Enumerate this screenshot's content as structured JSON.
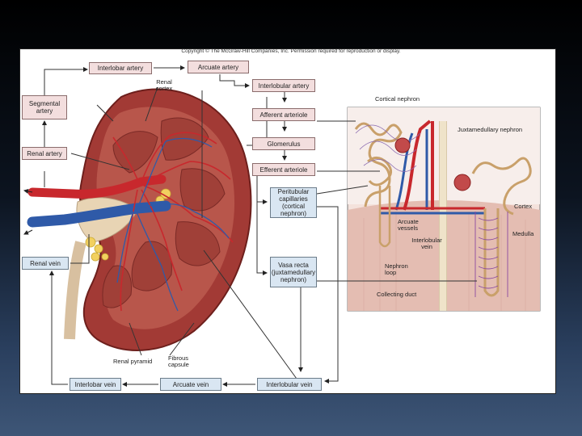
{
  "copyright": "Copyright © The McGraw-Hill Companies, Inc. Permission required for reproduction or display.",
  "flow_boxes": {
    "interlobar_artery": "Interlobar artery",
    "arcuate_artery": "Arcuate artery",
    "interlobular_artery": "Interlobular artery",
    "afferent_arteriole": "Afferent arteriole",
    "glomerulus": "Glomerulus",
    "efferent_arteriole": "Efferent arteriole",
    "peritubular_capillaries": "Peritubular capillaries (cortical nephron)",
    "vasa_recta": "Vasa recta (juxtamedullary nephron)",
    "segmental_artery": "Segmental artery",
    "renal_artery": "Renal artery",
    "renal_vein": "Renal vein",
    "interlobar_vein": "Interlobar vein",
    "arcuate_vein": "Arcuate vein",
    "interlobular_vein": "Interlobular vein"
  },
  "kidney_labels": {
    "renal_cortex": "Renal cortex",
    "renal_pyramid": "Renal pyramid",
    "fibrous_capsule": "Fibrous capsule"
  },
  "nephron_labels": {
    "cortical_nephron": "Cortical nephron",
    "juxtamedullary_nephron": "Juxtamedullary nephron",
    "cortex": "Cortex",
    "medulla": "Medulla",
    "arcuate_vessels": "Arcuate vessels",
    "interlobular_vein": "Interlobular vein",
    "nephron_loop": "Nephron loop",
    "collecting_duct": "Collecting duct"
  },
  "colors": {
    "artery": "#c8282d",
    "vein": "#2f5aa8",
    "pink_box": "#f3dede",
    "blue_box": "#d9e6f2",
    "kidney_cortex": "#a8413a",
    "medulla_bg": "#e9c9c0"
  }
}
